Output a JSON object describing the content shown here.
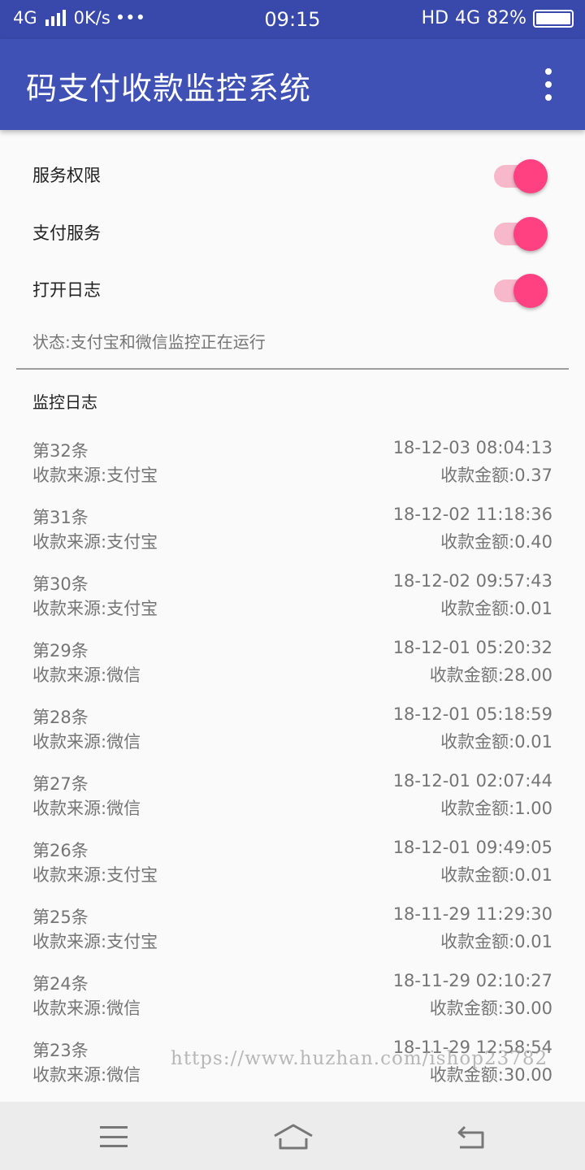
{
  "status_bar": {
    "network_left": "4G",
    "speed": "0K/s",
    "dots": "•••",
    "time": "09:15",
    "hd": "HD",
    "network_right": "4G",
    "battery": "82%"
  },
  "app_bar": {
    "title": "码支付收款监控系统",
    "menu_icon": "more-vert-icon"
  },
  "settings": [
    {
      "label": "服务权限",
      "enabled": true
    },
    {
      "label": "支付服务",
      "enabled": true
    },
    {
      "label": "打开日志",
      "enabled": true
    }
  ],
  "status_text": "状态:支付宝和微信监控正在运行",
  "log_title": "监控日志",
  "logs": [
    {
      "index": "第32条",
      "time": "18-12-03 08:04:13",
      "source": "收款来源:支付宝",
      "amount": "收款金额:0.37"
    },
    {
      "index": "第31条",
      "time": "18-12-02 11:18:36",
      "source": "收款来源:支付宝",
      "amount": "收款金额:0.40"
    },
    {
      "index": "第30条",
      "time": "18-12-02 09:57:43",
      "source": "收款来源:支付宝",
      "amount": "收款金额:0.01"
    },
    {
      "index": "第29条",
      "time": "18-12-01 05:20:32",
      "source": "收款来源:微信",
      "amount": "收款金额:28.00"
    },
    {
      "index": "第28条",
      "time": "18-12-01 05:18:59",
      "source": "收款来源:微信",
      "amount": "收款金额:0.01"
    },
    {
      "index": "第27条",
      "time": "18-12-01 02:07:44",
      "source": "收款来源:微信",
      "amount": "收款金额:1.00"
    },
    {
      "index": "第26条",
      "time": "18-12-01 09:49:05",
      "source": "收款来源:支付宝",
      "amount": "收款金额:0.01"
    },
    {
      "index": "第25条",
      "time": "18-11-29 11:29:30",
      "source": "收款来源:支付宝",
      "amount": "收款金额:0.01"
    },
    {
      "index": "第24条",
      "time": "18-11-29 02:10:27",
      "source": "收款来源:微信",
      "amount": "收款金额:30.00"
    },
    {
      "index": "第23条",
      "time": "18-11-29 12:58:54",
      "source": "收款来源:微信",
      "amount": "收款金额:30.00"
    }
  ],
  "watermark": "https://www.huzhan.com/ishop23782",
  "nav_bar": {
    "menu_icon": "menu-icon",
    "home_icon": "home-icon",
    "back_icon": "back-icon"
  },
  "colors": {
    "primary_dark": "#3949ab",
    "primary": "#3f51b5",
    "accent": "#ff4081"
  }
}
